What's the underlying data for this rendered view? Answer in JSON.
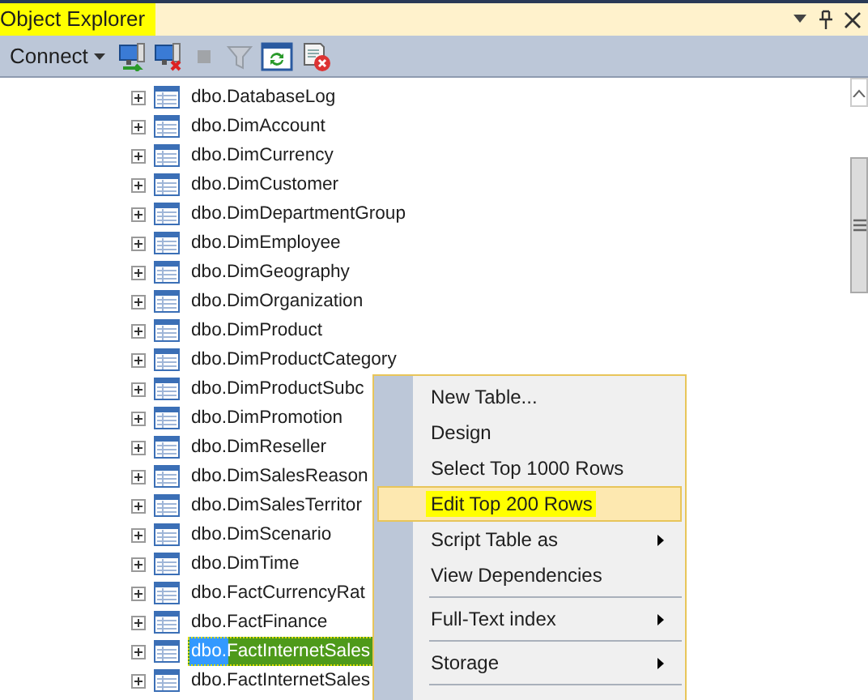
{
  "window": {
    "title": "Object Explorer",
    "highlighted": true
  },
  "toolbar": {
    "connect_label": "Connect",
    "items": [
      {
        "kind": "connect",
        "disabled": false
      },
      {
        "kind": "disconnect",
        "disabled": false
      },
      {
        "kind": "stop",
        "disabled": true
      },
      {
        "kind": "filter",
        "disabled": true
      },
      {
        "kind": "refresh",
        "disabled": false
      },
      {
        "kind": "script",
        "disabled": false
      }
    ]
  },
  "tree": {
    "rows": [
      {
        "label": "dbo.DatabaseLog",
        "expanded": false,
        "selected": false,
        "highlighted": false
      },
      {
        "label": "dbo.DimAccount",
        "expanded": false,
        "selected": false,
        "highlighted": false
      },
      {
        "label": "dbo.DimCurrency",
        "expanded": false,
        "selected": false,
        "highlighted": false
      },
      {
        "label": "dbo.DimCustomer",
        "expanded": false,
        "selected": false,
        "highlighted": false
      },
      {
        "label": "dbo.DimDepartmentGroup",
        "expanded": false,
        "selected": false,
        "highlighted": false
      },
      {
        "label": "dbo.DimEmployee",
        "expanded": false,
        "selected": false,
        "highlighted": false
      },
      {
        "label": "dbo.DimGeography",
        "expanded": false,
        "selected": false,
        "highlighted": false
      },
      {
        "label": "dbo.DimOrganization",
        "expanded": false,
        "selected": false,
        "highlighted": false
      },
      {
        "label": "dbo.DimProduct",
        "expanded": false,
        "selected": false,
        "highlighted": false
      },
      {
        "label": "dbo.DimProductCategory",
        "expanded": false,
        "selected": false,
        "highlighted": false
      },
      {
        "label": "dbo.DimProductSubc",
        "expanded": false,
        "selected": false,
        "highlighted": false
      },
      {
        "label": "dbo.DimPromotion",
        "expanded": false,
        "selected": false,
        "highlighted": false
      },
      {
        "label": "dbo.DimReseller",
        "expanded": false,
        "selected": false,
        "highlighted": false
      },
      {
        "label": "dbo.DimSalesReason",
        "expanded": false,
        "selected": false,
        "highlighted": false
      },
      {
        "label": "dbo.DimSalesTerritor",
        "expanded": false,
        "selected": false,
        "highlighted": false
      },
      {
        "label": "dbo.DimScenario",
        "expanded": false,
        "selected": false,
        "highlighted": false
      },
      {
        "label": "dbo.DimTime",
        "expanded": false,
        "selected": false,
        "highlighted": false
      },
      {
        "label": "dbo.FactCurrencyRat",
        "expanded": false,
        "selected": false,
        "highlighted": false
      },
      {
        "label": "dbo.FactFinance",
        "expanded": false,
        "selected": false,
        "highlighted": false
      },
      {
        "label": "dbo.FactInternetSales",
        "expanded": false,
        "selected": true,
        "highlighted": true
      },
      {
        "label": "dbo.FactInternetSales",
        "expanded": false,
        "selected": false,
        "highlighted": false
      }
    ]
  },
  "context_menu": {
    "items": [
      {
        "kind": "item",
        "label": "New Table...",
        "submenu": false,
        "selected": false,
        "highlighted": false
      },
      {
        "kind": "item",
        "label": "Design",
        "submenu": false,
        "selected": false,
        "highlighted": false
      },
      {
        "kind": "item",
        "label": "Select Top 1000 Rows",
        "submenu": false,
        "selected": false,
        "highlighted": false
      },
      {
        "kind": "item",
        "label": "Edit Top 200 Rows",
        "submenu": false,
        "selected": true,
        "highlighted": true
      },
      {
        "kind": "item",
        "label": "Script Table as",
        "submenu": true,
        "selected": false,
        "highlighted": false
      },
      {
        "kind": "item",
        "label": "View Dependencies",
        "submenu": false,
        "selected": false,
        "highlighted": false
      },
      {
        "kind": "separator"
      },
      {
        "kind": "item",
        "label": "Full-Text index",
        "submenu": true,
        "selected": false,
        "highlighted": false
      },
      {
        "kind": "separator"
      },
      {
        "kind": "item",
        "label": "Storage",
        "submenu": true,
        "selected": false,
        "highlighted": false
      },
      {
        "kind": "separator"
      }
    ]
  }
}
